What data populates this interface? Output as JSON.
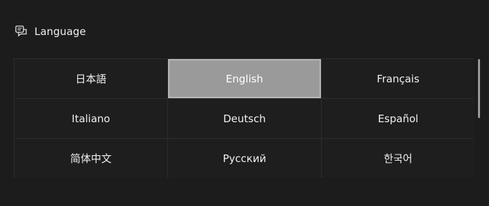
{
  "header": {
    "icon": "language-icon",
    "title": "Language"
  },
  "languages": [
    {
      "label": "日本語",
      "selected": false
    },
    {
      "label": "English",
      "selected": true
    },
    {
      "label": "Français",
      "selected": false
    },
    {
      "label": "Italiano",
      "selected": false
    },
    {
      "label": "Deutsch",
      "selected": false
    },
    {
      "label": "Español",
      "selected": false
    },
    {
      "label": "简体中文",
      "selected": false
    },
    {
      "label": "Русский",
      "selected": false
    },
    {
      "label": "한국어",
      "selected": false
    }
  ],
  "colors": {
    "background": "#1c1c1c",
    "selected": "#9a9a9a",
    "border": "#2e2e2e"
  }
}
